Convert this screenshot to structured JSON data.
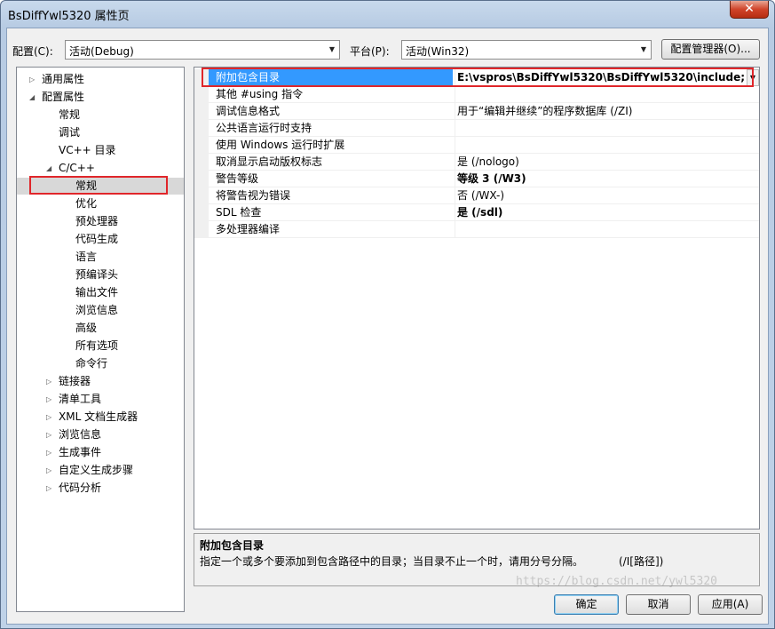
{
  "window": {
    "title": "BsDiffYwl5320 属性页",
    "close_label": "✕"
  },
  "toolbar": {
    "config_label": "配置(C):",
    "config_value": "活动(Debug)",
    "platform_label": "平台(P):",
    "platform_value": "活动(Win32)",
    "config_manager_label": "配置管理器(O)..."
  },
  "tree": {
    "items": [
      {
        "label": "通用属性",
        "expander": "▷"
      },
      {
        "label": "配置属性",
        "expander": "◢"
      },
      {
        "label": "常规"
      },
      {
        "label": "调试"
      },
      {
        "label": "VC++ 目录"
      },
      {
        "label": "C/C++",
        "expander": "◢"
      },
      {
        "label": "常规"
      },
      {
        "label": "优化"
      },
      {
        "label": "预处理器"
      },
      {
        "label": "代码生成"
      },
      {
        "label": "语言"
      },
      {
        "label": "预编译头"
      },
      {
        "label": "输出文件"
      },
      {
        "label": "浏览信息"
      },
      {
        "label": "高级"
      },
      {
        "label": "所有选项"
      },
      {
        "label": "命令行"
      },
      {
        "label": "链接器",
        "expander": "▷"
      },
      {
        "label": "清单工具",
        "expander": "▷"
      },
      {
        "label": "XML 文档生成器",
        "expander": "▷"
      },
      {
        "label": "浏览信息",
        "expander": "▷"
      },
      {
        "label": "生成事件",
        "expander": "▷"
      },
      {
        "label": "自定义生成步骤",
        "expander": "▷"
      },
      {
        "label": "代码分析",
        "expander": "▷"
      }
    ]
  },
  "grid": {
    "dropdown_arrow": "▼",
    "rows": [
      {
        "name": "附加包含目录",
        "value": "E:\\vspros\\BsDiffYwl5320\\BsDiffYwl5320\\include;"
      },
      {
        "name": "其他 #using 指令",
        "value": ""
      },
      {
        "name": "调试信息格式",
        "value": "用于“编辑并继续”的程序数据库 (/ZI)"
      },
      {
        "name": "公共语言运行时支持",
        "value": ""
      },
      {
        "name": "使用 Windows 运行时扩展",
        "value": ""
      },
      {
        "name": "取消显示启动版权标志",
        "value": "是 (/nologo)"
      },
      {
        "name": "警告等级",
        "value": "等级 3 (/W3)"
      },
      {
        "name": "将警告视为错误",
        "value": "否 (/WX-)"
      },
      {
        "name": "SDL 检查",
        "value": "是 (/sdl)"
      },
      {
        "name": "多处理器编译",
        "value": ""
      }
    ]
  },
  "description": {
    "title": "附加包含目录",
    "text": "指定一个或多个要添加到包含路径中的目录；当目录不止一个时，请用分号分隔。",
    "switch": "(/I[路径])"
  },
  "buttons": {
    "ok": "确定",
    "cancel": "取消",
    "apply": "应用(A)"
  },
  "watermark": "https://blog.csdn.net/ywl5320",
  "colors": {
    "selection": "#3399ff",
    "highlight_box": "#e0262a"
  }
}
